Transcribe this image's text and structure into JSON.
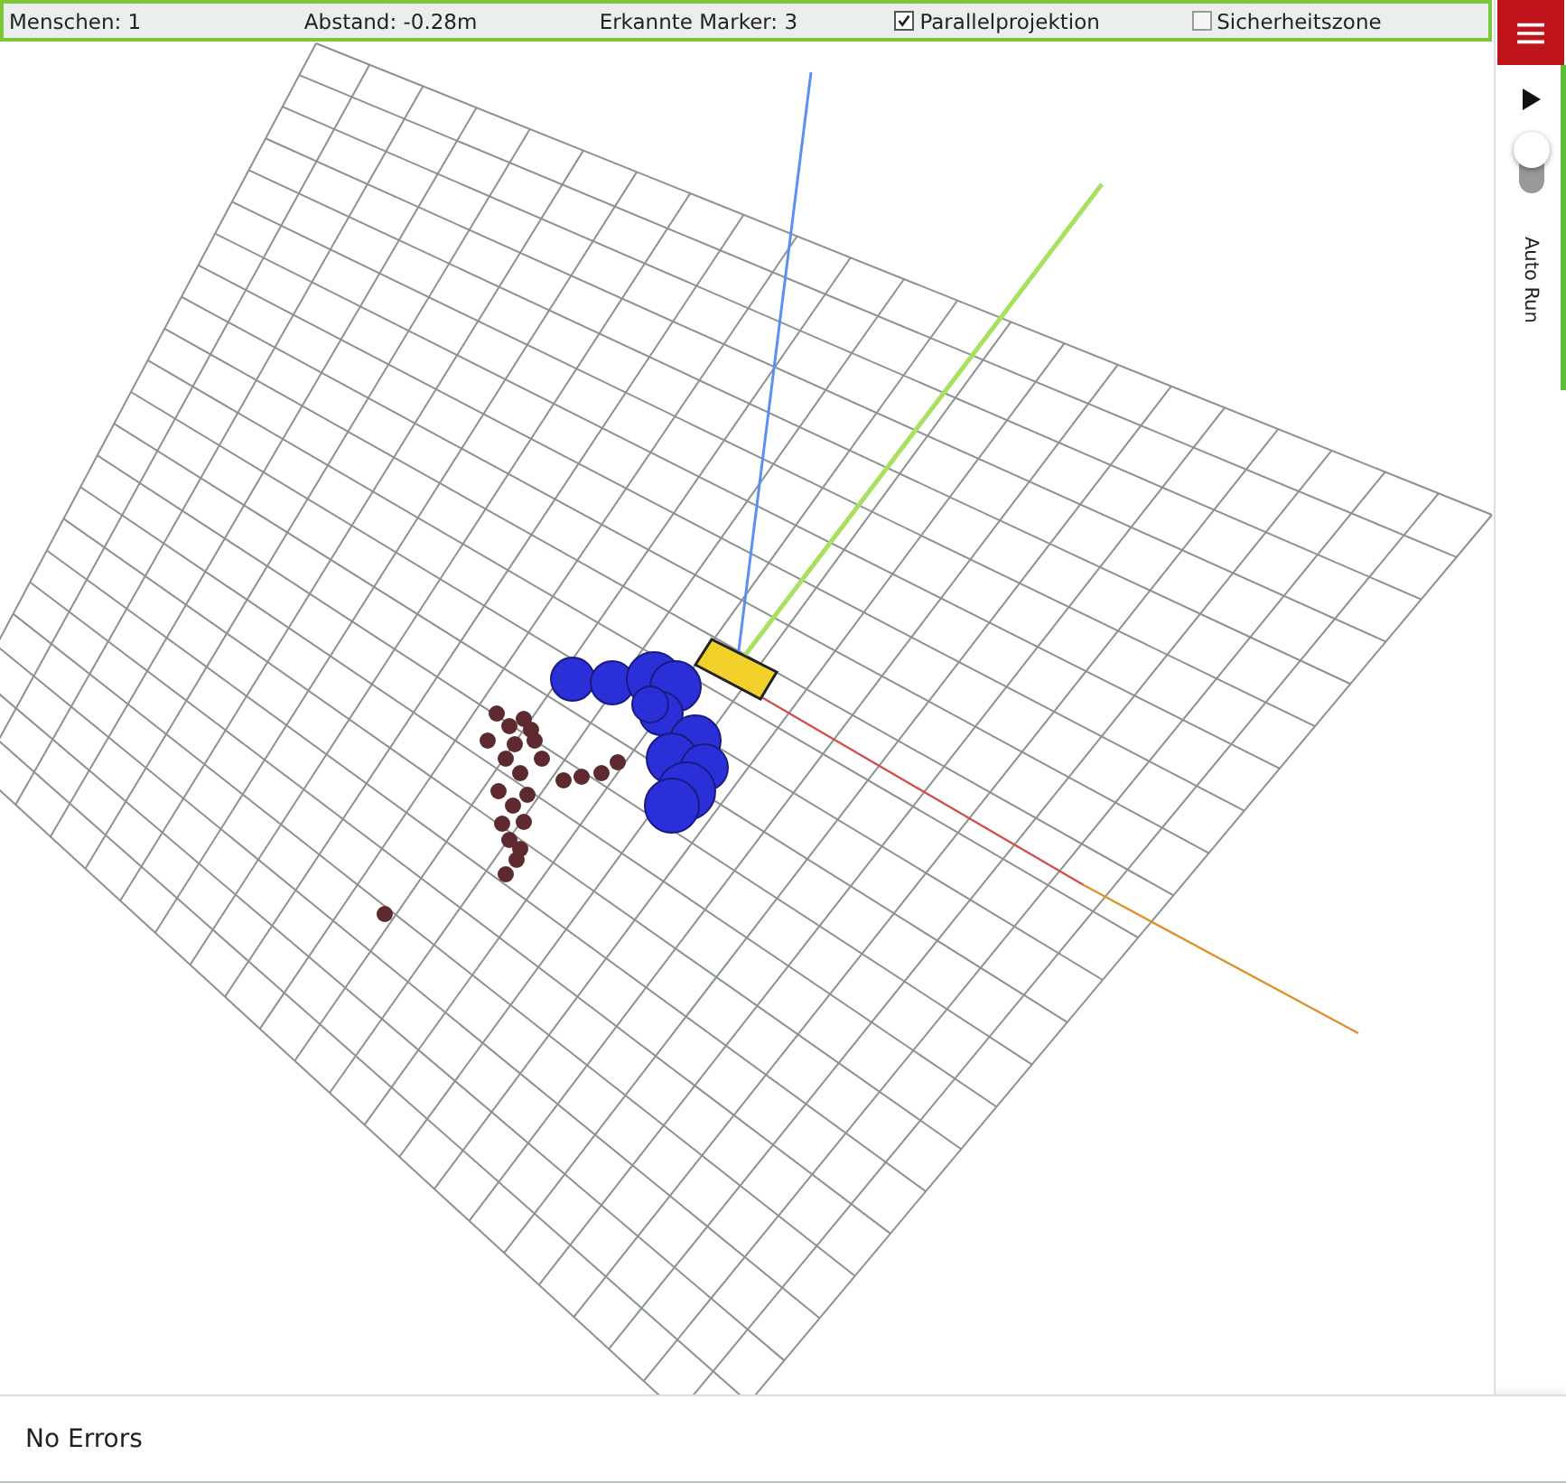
{
  "status_bar": {
    "readouts": [
      "Menschen: 1",
      "Abstand: -0.28m",
      "Erkannte Marker: 3"
    ],
    "options": [
      {
        "label": "Parallelprojektion",
        "checked": true
      },
      {
        "label": "Sicherheitszone",
        "checked": false
      }
    ]
  },
  "sidebar": {
    "auto_run": {
      "label": "Auto Run",
      "on": false
    }
  },
  "console": {
    "message": "No Errors"
  }
}
